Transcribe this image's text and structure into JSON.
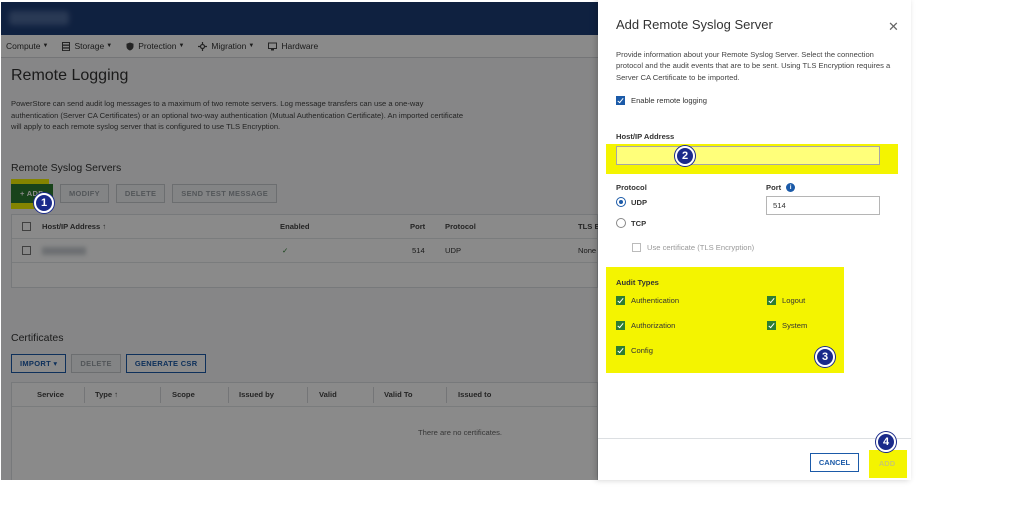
{
  "menu": {
    "items": [
      {
        "label": "Compute",
        "icon": "none",
        "caret": true
      },
      {
        "label": "Storage",
        "icon": "storage-icon",
        "caret": true
      },
      {
        "label": "Protection",
        "icon": "shield-icon",
        "caret": true
      },
      {
        "label": "Migration",
        "icon": "migration-icon",
        "caret": true
      },
      {
        "label": "Hardware",
        "icon": "hardware-icon",
        "caret": false
      }
    ]
  },
  "page": {
    "title": "Remote Logging",
    "description": "PowerStore can send audit log messages to a maximum of two remote servers. Log message transfers can use a one-way authentication (Server CA Certificates) or an optional two-way authentication (Mutual Authentication Certificate). An imported certificate will apply to each remote syslog server that is configured to use TLS Encryption."
  },
  "syslog": {
    "section_title": "Remote Syslog Servers",
    "toolbar": {
      "add": "+ ADD",
      "modify": "MODIFY",
      "delete": "DELETE",
      "send_test": "SEND TEST MESSAGE"
    },
    "columns": {
      "host": "Host/IP Address ↑",
      "enabled": "Enabled",
      "port": "Port",
      "protocol": "Protocol",
      "tls": "TLS En"
    },
    "rows": [
      {
        "enabled": "✓",
        "port": "514",
        "protocol": "UDP",
        "tls": "None"
      }
    ]
  },
  "certificates": {
    "section_title": "Certificates",
    "toolbar": {
      "import": "IMPORT ▾",
      "delete": "DELETE",
      "generate_csr": "GENERATE CSR"
    },
    "columns": [
      "Service",
      "Type ↑",
      "Scope",
      "Issued by",
      "Valid",
      "Valid To",
      "Issued to"
    ],
    "empty_text": "There are no certificates."
  },
  "dialog": {
    "title": "Add Remote Syslog Server",
    "close_glyph": "✕",
    "description": "Provide information about your Remote Syslog Server. Select the connection protocol and the audit events that are to be sent. Using TLS Encryption requires a Server CA Certificate to be imported.",
    "enable_label": "Enable remote logging",
    "enable_checked": true,
    "host_label": "Host/IP Address",
    "host_value": "",
    "protocol_label": "Protocol",
    "protocols": [
      {
        "label": "UDP",
        "selected": true
      },
      {
        "label": "TCP",
        "selected": false
      }
    ],
    "port_label": "Port",
    "port_value": "514",
    "tls_label": "Use certificate (TLS Encryption)",
    "audit_label": "Audit Types",
    "audit_types": [
      {
        "label": "Authentication",
        "checked": true
      },
      {
        "label": "Logout",
        "checked": true
      },
      {
        "label": "Authorization",
        "checked": true
      },
      {
        "label": "System",
        "checked": true
      },
      {
        "label": "Config",
        "checked": true
      }
    ],
    "cancel_label": "CANCEL",
    "add_label": "ADD"
  },
  "steps": [
    "1",
    "2",
    "3",
    "4"
  ],
  "colors": {
    "highlight": "#f4f400",
    "step_marker": "#1a2a8a",
    "primary_blue": "#1b5aa8",
    "check_green": "#2e7d32",
    "topbar": "#1d3d76"
  }
}
